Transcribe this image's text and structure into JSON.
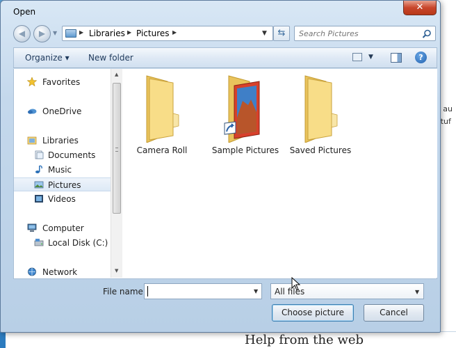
{
  "background": {
    "text_line1": "s au",
    "text_line2": "stuf",
    "help_text": "Help from the web"
  },
  "window": {
    "title": "Open",
    "close_label": "✕"
  },
  "address": {
    "crumbs": [
      "Libraries",
      "Pictures"
    ],
    "search_placeholder": "Search Pictures"
  },
  "toolbar": {
    "organize_label": "Organize ▾",
    "new_folder_label": "New folder",
    "help_label": "?"
  },
  "nav": {
    "items": [
      {
        "label": "Favorites",
        "icon": "star-icon"
      },
      {
        "label": "OneDrive",
        "icon": "cloud-icon"
      },
      {
        "label": "Libraries",
        "icon": "library-icon"
      },
      {
        "label": "Documents",
        "icon": "documents-icon"
      },
      {
        "label": "Music",
        "icon": "music-icon"
      },
      {
        "label": "Pictures",
        "icon": "pictures-icon",
        "selected": true
      },
      {
        "label": "Videos",
        "icon": "videos-icon"
      },
      {
        "label": "Computer",
        "icon": "computer-icon"
      },
      {
        "label": "Local Disk (C:)",
        "icon": "drive-icon"
      },
      {
        "label": "Network",
        "icon": "network-icon"
      }
    ]
  },
  "files": [
    {
      "label": "Camera Roll",
      "icon": "folder-icon"
    },
    {
      "label": "Sample Pictures",
      "icon": "folder-shortcut-icon"
    },
    {
      "label": "Saved Pictures",
      "icon": "folder-icon"
    }
  ],
  "bottom": {
    "filename_label": "File name:",
    "filename_value": "",
    "filetype_value": "All files",
    "choose_label": "Choose picture",
    "cancel_label": "Cancel"
  },
  "colors": {
    "close_button": "#c8462c",
    "folder": "#f5d67a",
    "selection": "#dde9f6",
    "help_icon": "#1f5fae"
  }
}
